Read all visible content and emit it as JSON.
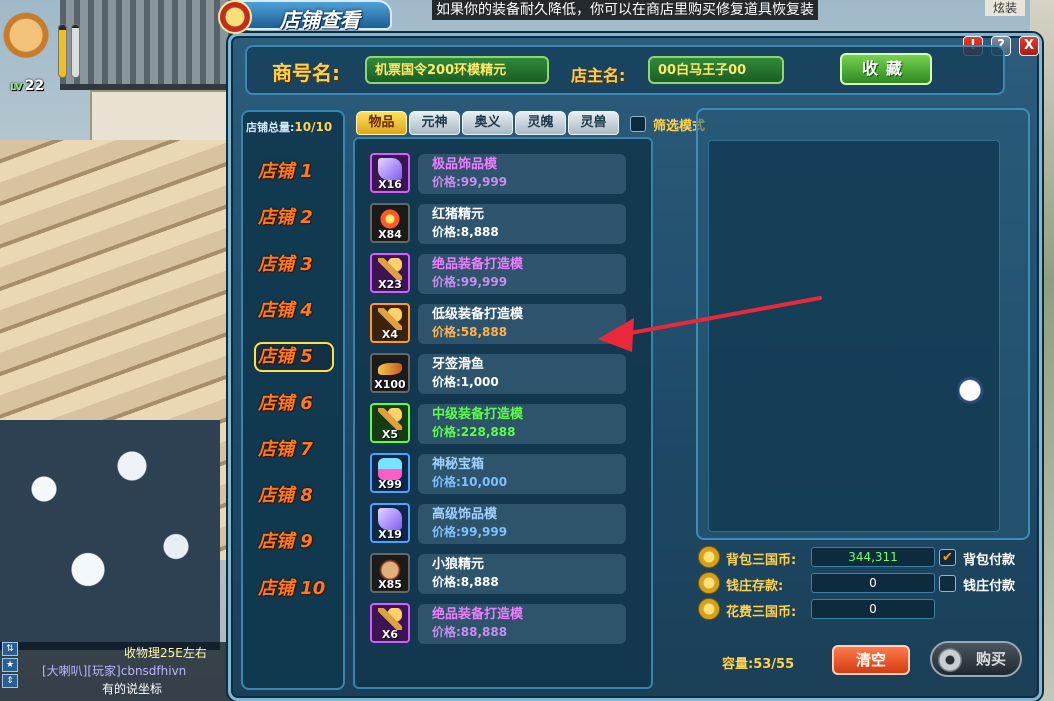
{
  "notice": "如果你的装备耐久降低，你可以在商店里购买修复道具恢复装",
  "top_right_button": "炫装",
  "hud": {
    "level": "22",
    "level_prefix": "LV"
  },
  "window": {
    "title": "店铺查看",
    "controls": {
      "alert": "!",
      "help": "?",
      "close": "X"
    }
  },
  "header": {
    "shop_name_label": "商号名:",
    "shop_name_value": "机票国令200环模精元",
    "owner_label": "店主名:",
    "owner_value": "00白马王子00",
    "favorite_button": "收藏"
  },
  "stores": {
    "total_label": "店铺总量:",
    "total_value": "10/10",
    "items": [
      "店铺 1",
      "店铺 2",
      "店铺 3",
      "店铺 4",
      "店铺 5",
      "店铺 6",
      "店铺 7",
      "店铺 8",
      "店铺 9",
      "店铺 10"
    ],
    "active_index": 4
  },
  "tabs": [
    {
      "label": "物品",
      "active": true
    },
    {
      "label": "元神",
      "active": false
    },
    {
      "label": "奥义",
      "active": false
    },
    {
      "label": "灵魄",
      "active": false
    },
    {
      "label": "灵兽",
      "active": false
    }
  ],
  "filter_label": "筛选模式",
  "items": [
    {
      "name": "极品饰品模",
      "price": "价格:99,999",
      "qty": "X16",
      "quality": "purple",
      "icon": "telescope-icon"
    },
    {
      "name": "红猪精元",
      "price": "价格:8,888",
      "qty": "X84",
      "quality": "white",
      "icon": "pig-essence-icon"
    },
    {
      "name": "绝品装备打造模",
      "price": "价格:99,999",
      "qty": "X23",
      "quality": "purple",
      "icon": "forge-mold-icon"
    },
    {
      "name": "低级装备打造模",
      "price": "价格:58,888",
      "qty": "X4",
      "quality": "orange",
      "icon": "forge-mold-icon"
    },
    {
      "name": "牙签滑鱼",
      "price": "价格:1,000",
      "qty": "X100",
      "quality": "white",
      "icon": "fish-icon"
    },
    {
      "name": "中级装备打造模",
      "price": "价格:228,888",
      "qty": "X5",
      "quality": "green",
      "icon": "forge-mold-icon"
    },
    {
      "name": "神秘宝箱",
      "price": "价格:10,000",
      "qty": "X99",
      "quality": "blue",
      "icon": "treasure-box-icon"
    },
    {
      "name": "高级饰品模",
      "price": "价格:99,999",
      "qty": "X19",
      "quality": "blue",
      "icon": "telescope-icon"
    },
    {
      "name": "小狼精元",
      "price": "价格:8,888",
      "qty": "X85",
      "quality": "white",
      "icon": "wolf-essence-icon"
    },
    {
      "name": "绝品装备打造模",
      "price": "价格:88,888",
      "qty": "X6",
      "quality": "purple",
      "icon": "forge-mold-icon"
    }
  ],
  "currency": [
    {
      "label": "背包三国币:",
      "value": "344,311",
      "checkbox_label": "背包付款",
      "checked": true
    },
    {
      "label": "钱庄存款:",
      "value": "0",
      "checkbox_label": "钱庄付款",
      "checked": false
    },
    {
      "label": "花费三国币:",
      "value": "0"
    }
  ],
  "capacity": "容量:53/55",
  "clear_button": "清空",
  "buy_button": "购买",
  "chat": {
    "line1": "收物理25E左右",
    "line2": "[大喇叭][玩家]cbnsdfhivn",
    "line3": "有的说坐标"
  },
  "colors": {
    "accent_gold": "#ffd34d",
    "store_orange": "#ff7a1a",
    "arrow_red": "#e8293a"
  }
}
